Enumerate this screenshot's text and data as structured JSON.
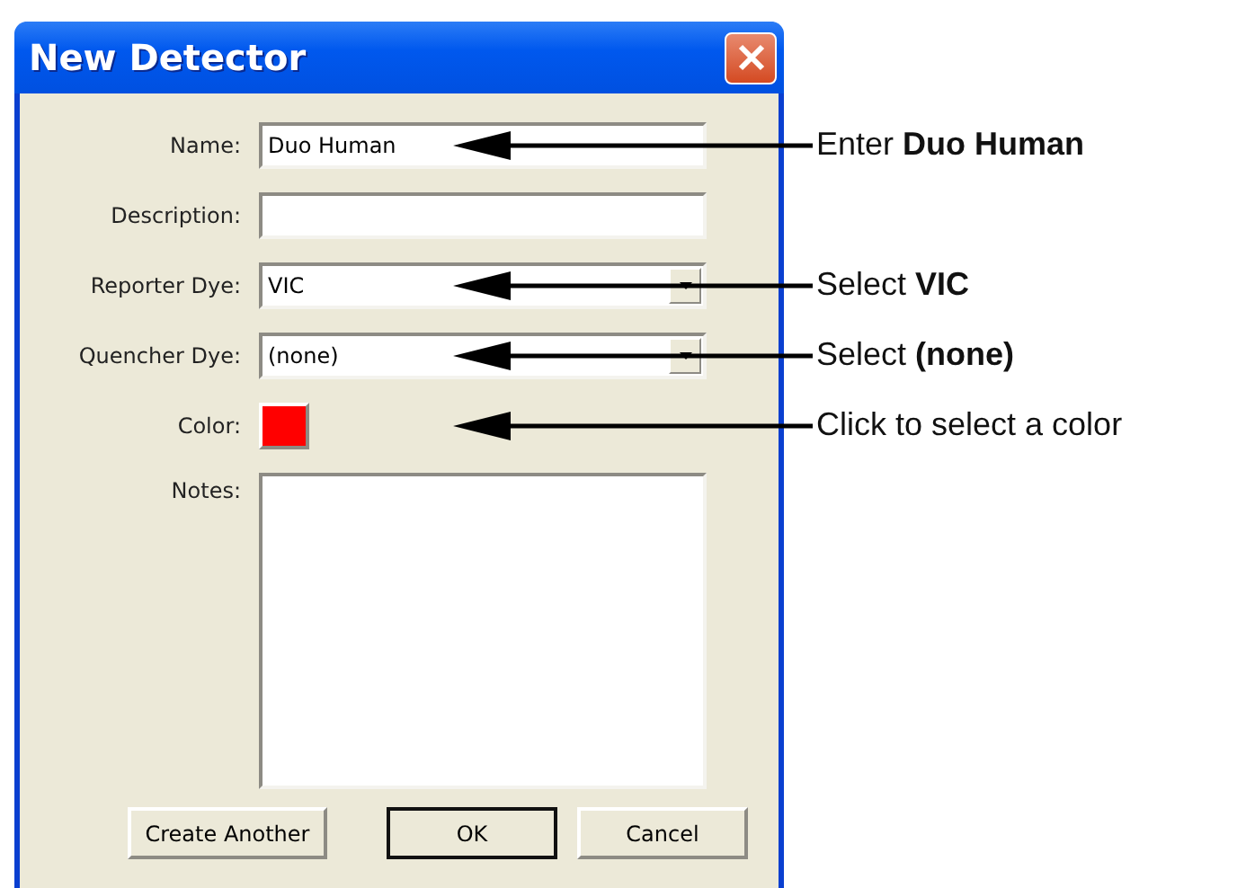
{
  "window": {
    "title": "New Detector"
  },
  "fields": [
    {
      "kind": "text",
      "label": "Name:",
      "value": "Duo Human",
      "callout": "Enter **Duo Human**"
    },
    {
      "kind": "text",
      "label": "Description:"
    },
    {
      "kind": "dropdown",
      "label": "Reporter Dye:",
      "value": "VIC",
      "callout": "Select **VIC**"
    },
    {
      "kind": "dropdown",
      "label": "Quencher Dye:",
      "value": "(none)",
      "callout": "Select **(none)**"
    },
    {
      "kind": "color",
      "label": "Color:",
      "color": "#ff0000",
      "callout": "Click to select a color"
    },
    {
      "kind": "textarea",
      "label": "Notes:"
    }
  ],
  "buttons": [
    {
      "label": "Create Another",
      "default": false
    },
    {
      "label": "OK",
      "default": true
    },
    {
      "label": "Cancel",
      "default": false
    }
  ]
}
